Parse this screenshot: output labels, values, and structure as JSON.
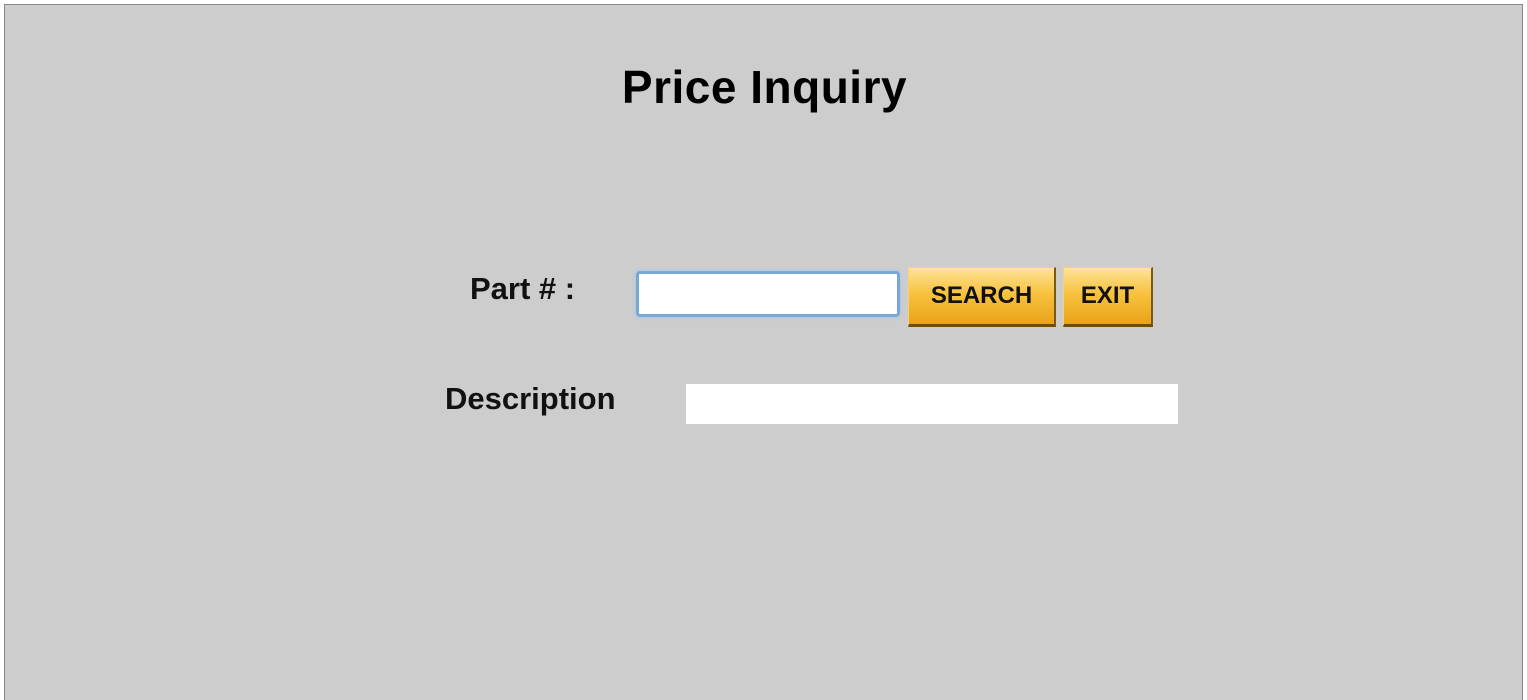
{
  "header": {
    "title": "Price Inquiry"
  },
  "form": {
    "part_label": "Part # :",
    "part_value": "",
    "description_label": "Description",
    "description_value": ""
  },
  "buttons": {
    "search_label": "SEARCH",
    "exit_label": "EXIT"
  },
  "colors": {
    "background": "#cdcdcd",
    "button_gradient_top": "#fde49a",
    "button_gradient_bottom": "#e8a419",
    "input_focus_border": "#7aa7d3"
  }
}
